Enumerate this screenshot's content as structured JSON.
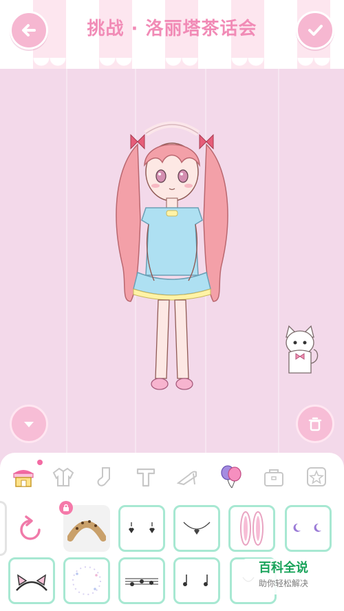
{
  "header": {
    "title": "挑战 · 洛丽塔茶话会",
    "back_icon": "arrow-left-icon",
    "confirm_icon": "checkmark-icon"
  },
  "stage": {
    "character": "chibi girl with pink twin-tail hair and blue ruffled dress",
    "pet": "white cat with pink bow",
    "left_button_icon": "chevron-down-icon",
    "right_button_icon": "trash-icon"
  },
  "categories": [
    {
      "name": "shop",
      "icon": "shop-icon",
      "active": true,
      "has_notification": true
    },
    {
      "name": "jacket",
      "icon": "jacket-icon",
      "active": false
    },
    {
      "name": "socks",
      "icon": "sock-icon",
      "active": false
    },
    {
      "name": "tops",
      "icon": "t-shirt-icon",
      "active": false
    },
    {
      "name": "shoes",
      "icon": "shoe-icon",
      "active": false
    },
    {
      "name": "balloons",
      "icon": "balloon-icon",
      "active": true
    },
    {
      "name": "bag",
      "icon": "bag-icon",
      "active": false
    },
    {
      "name": "favorites",
      "icon": "star-icon",
      "active": false
    }
  ],
  "items": [
    {
      "icon": "refresh-icon"
    },
    {
      "icon": "leopard-headband-icon",
      "locked": true
    },
    {
      "icon": "heart-earrings-icon"
    },
    {
      "icon": "heart-necklace-icon"
    },
    {
      "icon": "bunny-ears-icon"
    },
    {
      "icon": "moon-earrings-icon"
    },
    {
      "icon": "cat-ear-headband-icon"
    },
    {
      "icon": "sparkle-ring-icon"
    },
    {
      "icon": "music-notes-icon"
    },
    {
      "icon": "note-earrings-icon"
    },
    {
      "icon": "partial-item-icon"
    }
  ],
  "watermark": {
    "main": "百科全说",
    "sub": "助你轻松解决"
  },
  "colors": {
    "background": "#f3d9ea",
    "accent": "#f18bb6",
    "slot_border": "#a7e8d2",
    "watermark_green": "#19a35a"
  }
}
